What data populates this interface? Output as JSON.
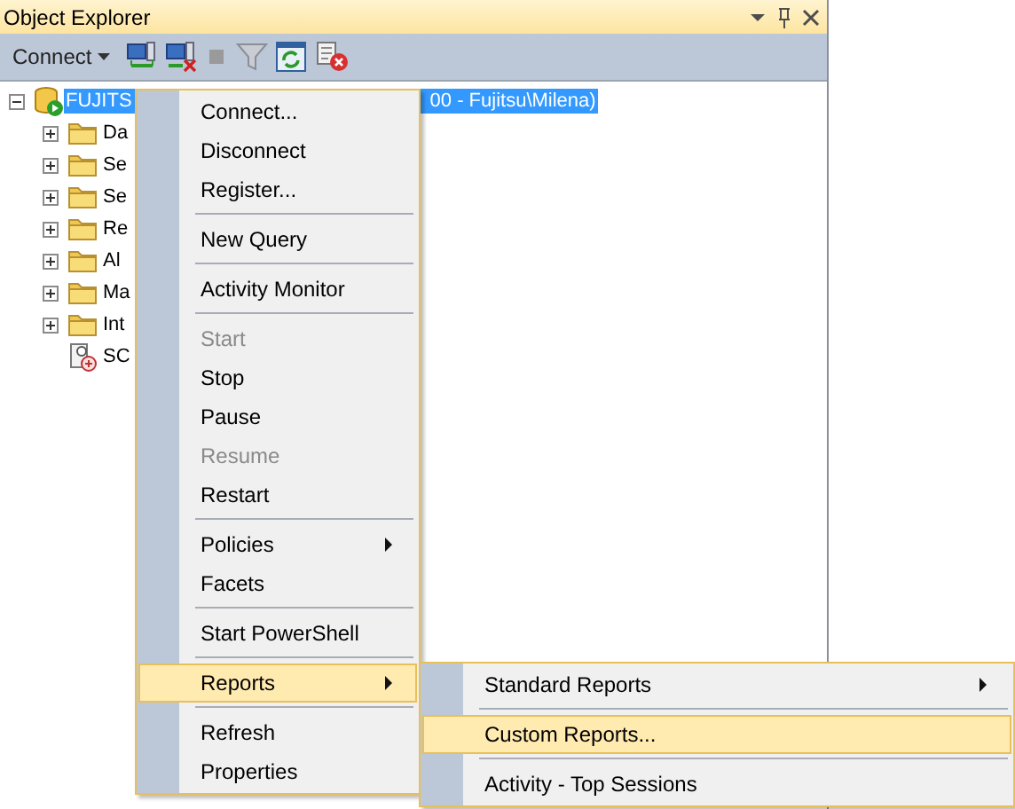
{
  "panel": {
    "title": "Object Explorer"
  },
  "toolbar": {
    "connect_label": "Connect"
  },
  "tree": {
    "root": {
      "label_start": "FUJITS",
      "label_end": "00 - Fujitsu\\Milena)",
      "selected": true,
      "expanded": true,
      "children": [
        {
          "label": "Da",
          "kind": "folder"
        },
        {
          "label": "Se",
          "kind": "folder"
        },
        {
          "label": "Se",
          "kind": "folder"
        },
        {
          "label": "Re",
          "kind": "folder"
        },
        {
          "label": "Al",
          "kind": "folder"
        },
        {
          "label": "Ma",
          "kind": "folder"
        },
        {
          "label": "Int",
          "kind": "folder"
        },
        {
          "label": "SC",
          "kind": "agent"
        }
      ]
    }
  },
  "context_menu": {
    "items": [
      {
        "kind": "item",
        "label": "Connect...",
        "disabled": false,
        "selected": false,
        "submenu": false
      },
      {
        "kind": "item",
        "label": "Disconnect",
        "disabled": false,
        "selected": false,
        "submenu": false
      },
      {
        "kind": "item",
        "label": "Register...",
        "disabled": false,
        "selected": false,
        "submenu": false
      },
      {
        "kind": "separator"
      },
      {
        "kind": "item",
        "label": "New Query",
        "disabled": false,
        "selected": false,
        "submenu": false
      },
      {
        "kind": "separator"
      },
      {
        "kind": "item",
        "label": "Activity Monitor",
        "disabled": false,
        "selected": false,
        "submenu": false
      },
      {
        "kind": "separator"
      },
      {
        "kind": "item",
        "label": "Start",
        "disabled": true,
        "selected": false,
        "submenu": false
      },
      {
        "kind": "item",
        "label": "Stop",
        "disabled": false,
        "selected": false,
        "submenu": false
      },
      {
        "kind": "item",
        "label": "Pause",
        "disabled": false,
        "selected": false,
        "submenu": false
      },
      {
        "kind": "item",
        "label": "Resume",
        "disabled": true,
        "selected": false,
        "submenu": false
      },
      {
        "kind": "item",
        "label": "Restart",
        "disabled": false,
        "selected": false,
        "submenu": false
      },
      {
        "kind": "separator"
      },
      {
        "kind": "item",
        "label": "Policies",
        "disabled": false,
        "selected": false,
        "submenu": true
      },
      {
        "kind": "item",
        "label": "Facets",
        "disabled": false,
        "selected": false,
        "submenu": false
      },
      {
        "kind": "separator"
      },
      {
        "kind": "item",
        "label": "Start PowerShell",
        "disabled": false,
        "selected": false,
        "submenu": false
      },
      {
        "kind": "separator"
      },
      {
        "kind": "item",
        "label": "Reports",
        "disabled": false,
        "selected": true,
        "submenu": true
      },
      {
        "kind": "separator"
      },
      {
        "kind": "item",
        "label": "Refresh",
        "disabled": false,
        "selected": false,
        "submenu": false
      },
      {
        "kind": "item",
        "label": "Properties",
        "disabled": false,
        "selected": false,
        "submenu": false
      }
    ]
  },
  "submenu": {
    "items": [
      {
        "kind": "item",
        "label": "Standard Reports",
        "disabled": false,
        "selected": false,
        "submenu": true
      },
      {
        "kind": "separator"
      },
      {
        "kind": "item",
        "label": "Custom Reports...",
        "disabled": false,
        "selected": true,
        "submenu": false
      },
      {
        "kind": "separator"
      },
      {
        "kind": "item",
        "label": "Activity - Top Sessions",
        "disabled": false,
        "selected": false,
        "submenu": false
      }
    ]
  }
}
